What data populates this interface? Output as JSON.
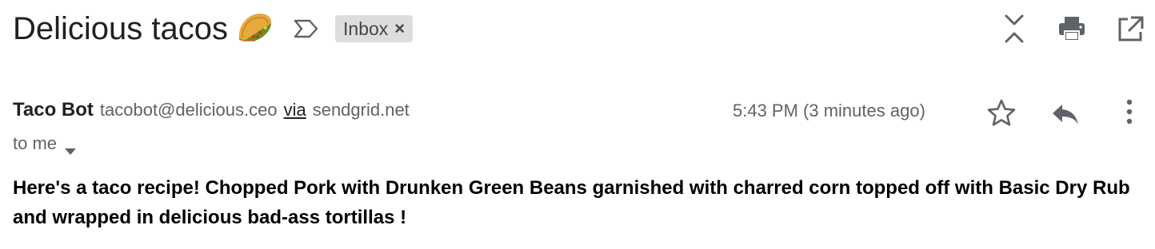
{
  "subject": {
    "title": "Delicious tacos",
    "emoji_icon": "taco-emoji-icon",
    "importance_icon": "important-marker-icon"
  },
  "label": {
    "name": "Inbox",
    "remove_glyph": "×"
  },
  "toolbar": {
    "icons": [
      "expand-collapse-all-icon",
      "print-icon",
      "open-in-new-window-icon"
    ]
  },
  "message": {
    "sender_name": "Taco Bot",
    "sender_email": "tacobot@delicious.ceo",
    "via_label": "via",
    "via_domain": "sendgrid.net",
    "timestamp": "5:43 PM (3 minutes ago)",
    "recipient": "to me",
    "body": "Here's a taco recipe! Chopped Pork with Drunken Green Beans garnished with charred corn topped off with Basic Dry Rub and wrapped in delicious bad-ass tortillas !",
    "actions": [
      "star-icon",
      "reply-icon",
      "more-options-icon"
    ]
  },
  "colors": {
    "text_primary": "#202124",
    "text_secondary": "#5f6368",
    "icon": "#5f6368",
    "chip_background": "#dddddd"
  }
}
